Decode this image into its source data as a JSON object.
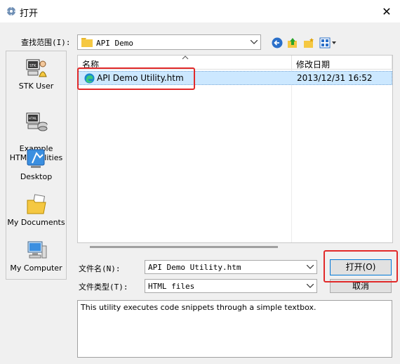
{
  "window": {
    "title": "打开",
    "close_glyph": "✕"
  },
  "lookin": {
    "label": "查找范围(I):",
    "value": "API Demo",
    "toolbar_icons": [
      "back-icon",
      "up-folder-icon",
      "new-folder-icon",
      "view-menu-icon"
    ]
  },
  "places": [
    {
      "label": "STK User",
      "icon": "stk-user-icon"
    },
    {
      "label": "Example\nHTML Utilities",
      "icon": "example-html-icon"
    },
    {
      "label": "Desktop",
      "icon": "desktop-icon"
    },
    {
      "label": "My Documents",
      "icon": "documents-icon"
    },
    {
      "label": "My Computer",
      "icon": "computer-icon"
    }
  ],
  "file_list": {
    "columns": [
      "名称",
      "修改日期"
    ],
    "rows": [
      {
        "name": "API Demo Utility.htm",
        "modified": "2013/12/31 16:52",
        "icon": "edge-html-icon",
        "selected": true
      }
    ]
  },
  "filename": {
    "label": "文件名(N):",
    "value": "API Demo Utility.htm"
  },
  "filetype": {
    "label": "文件类型(T):",
    "value": "HTML files"
  },
  "buttons": {
    "open": "打开(O)",
    "cancel": "取消"
  },
  "description": "This utility executes code snippets through a simple textbox.",
  "colors": {
    "selection": "#cce8ff",
    "highlight_box": "#e12a2a",
    "default_button_border": "#0078d7"
  }
}
